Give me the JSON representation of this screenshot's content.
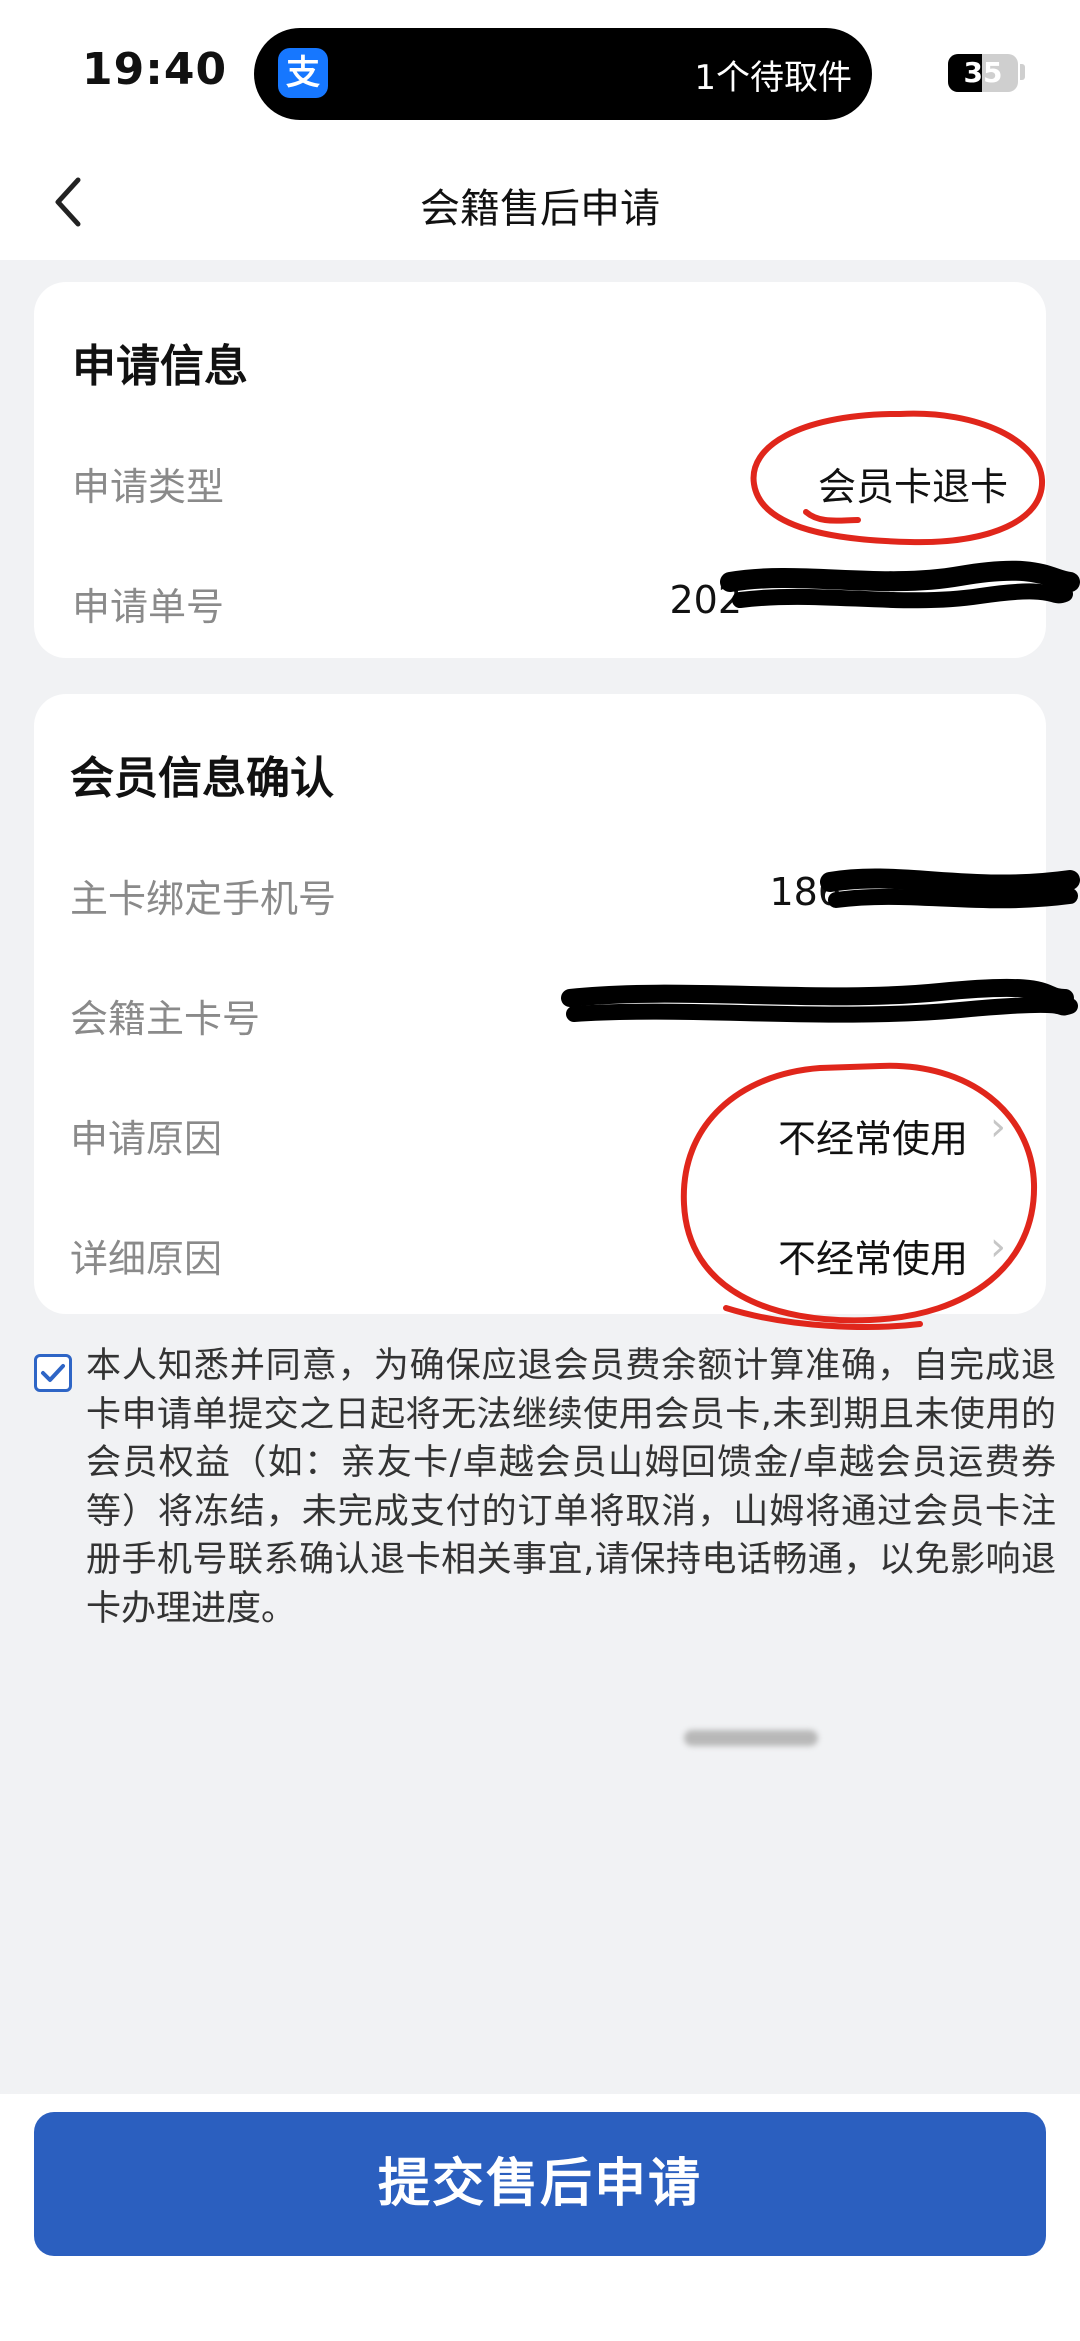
{
  "status_bar": {
    "time": "19:40",
    "app_icon_glyph": "支",
    "notification": "1个待取件",
    "battery": "35"
  },
  "nav": {
    "title": "会籍售后申请"
  },
  "application_info": {
    "title": "申请信息",
    "type_label": "申请类型",
    "type_value": "会员卡退卡",
    "number_label": "申请单号",
    "number_value_visible": "202"
  },
  "member_info": {
    "title": "会员信息确认",
    "phone_label": "主卡绑定手机号",
    "phone_value_visible": "186",
    "card_no_label": "会籍主卡号",
    "reason_label": "申请原因",
    "reason_value": "不经常使用",
    "detail_label": "详细原因",
    "detail_value": "不经常使用"
  },
  "agreement": {
    "checked": true,
    "text": "本人知悉并同意，为确保应退会员费余额计算准确，自完成退卡申请单提交之日起将无法继续使用会员卡,未到期且未使用的会员权益（如：亲友卡/卓越会员山姆回馈金/卓越会员运费券等）将冻结，未完成支付的订单将取消，山姆将通过会员卡注册手机号联系确认退卡相关事宜,请保持电话畅通，以免影响退卡办理进度。"
  },
  "submit_label": "提交售后申请",
  "colors": {
    "primary": "#2b5fbf",
    "annotation_red": "#e0261b",
    "background": "#f1f2f4"
  }
}
